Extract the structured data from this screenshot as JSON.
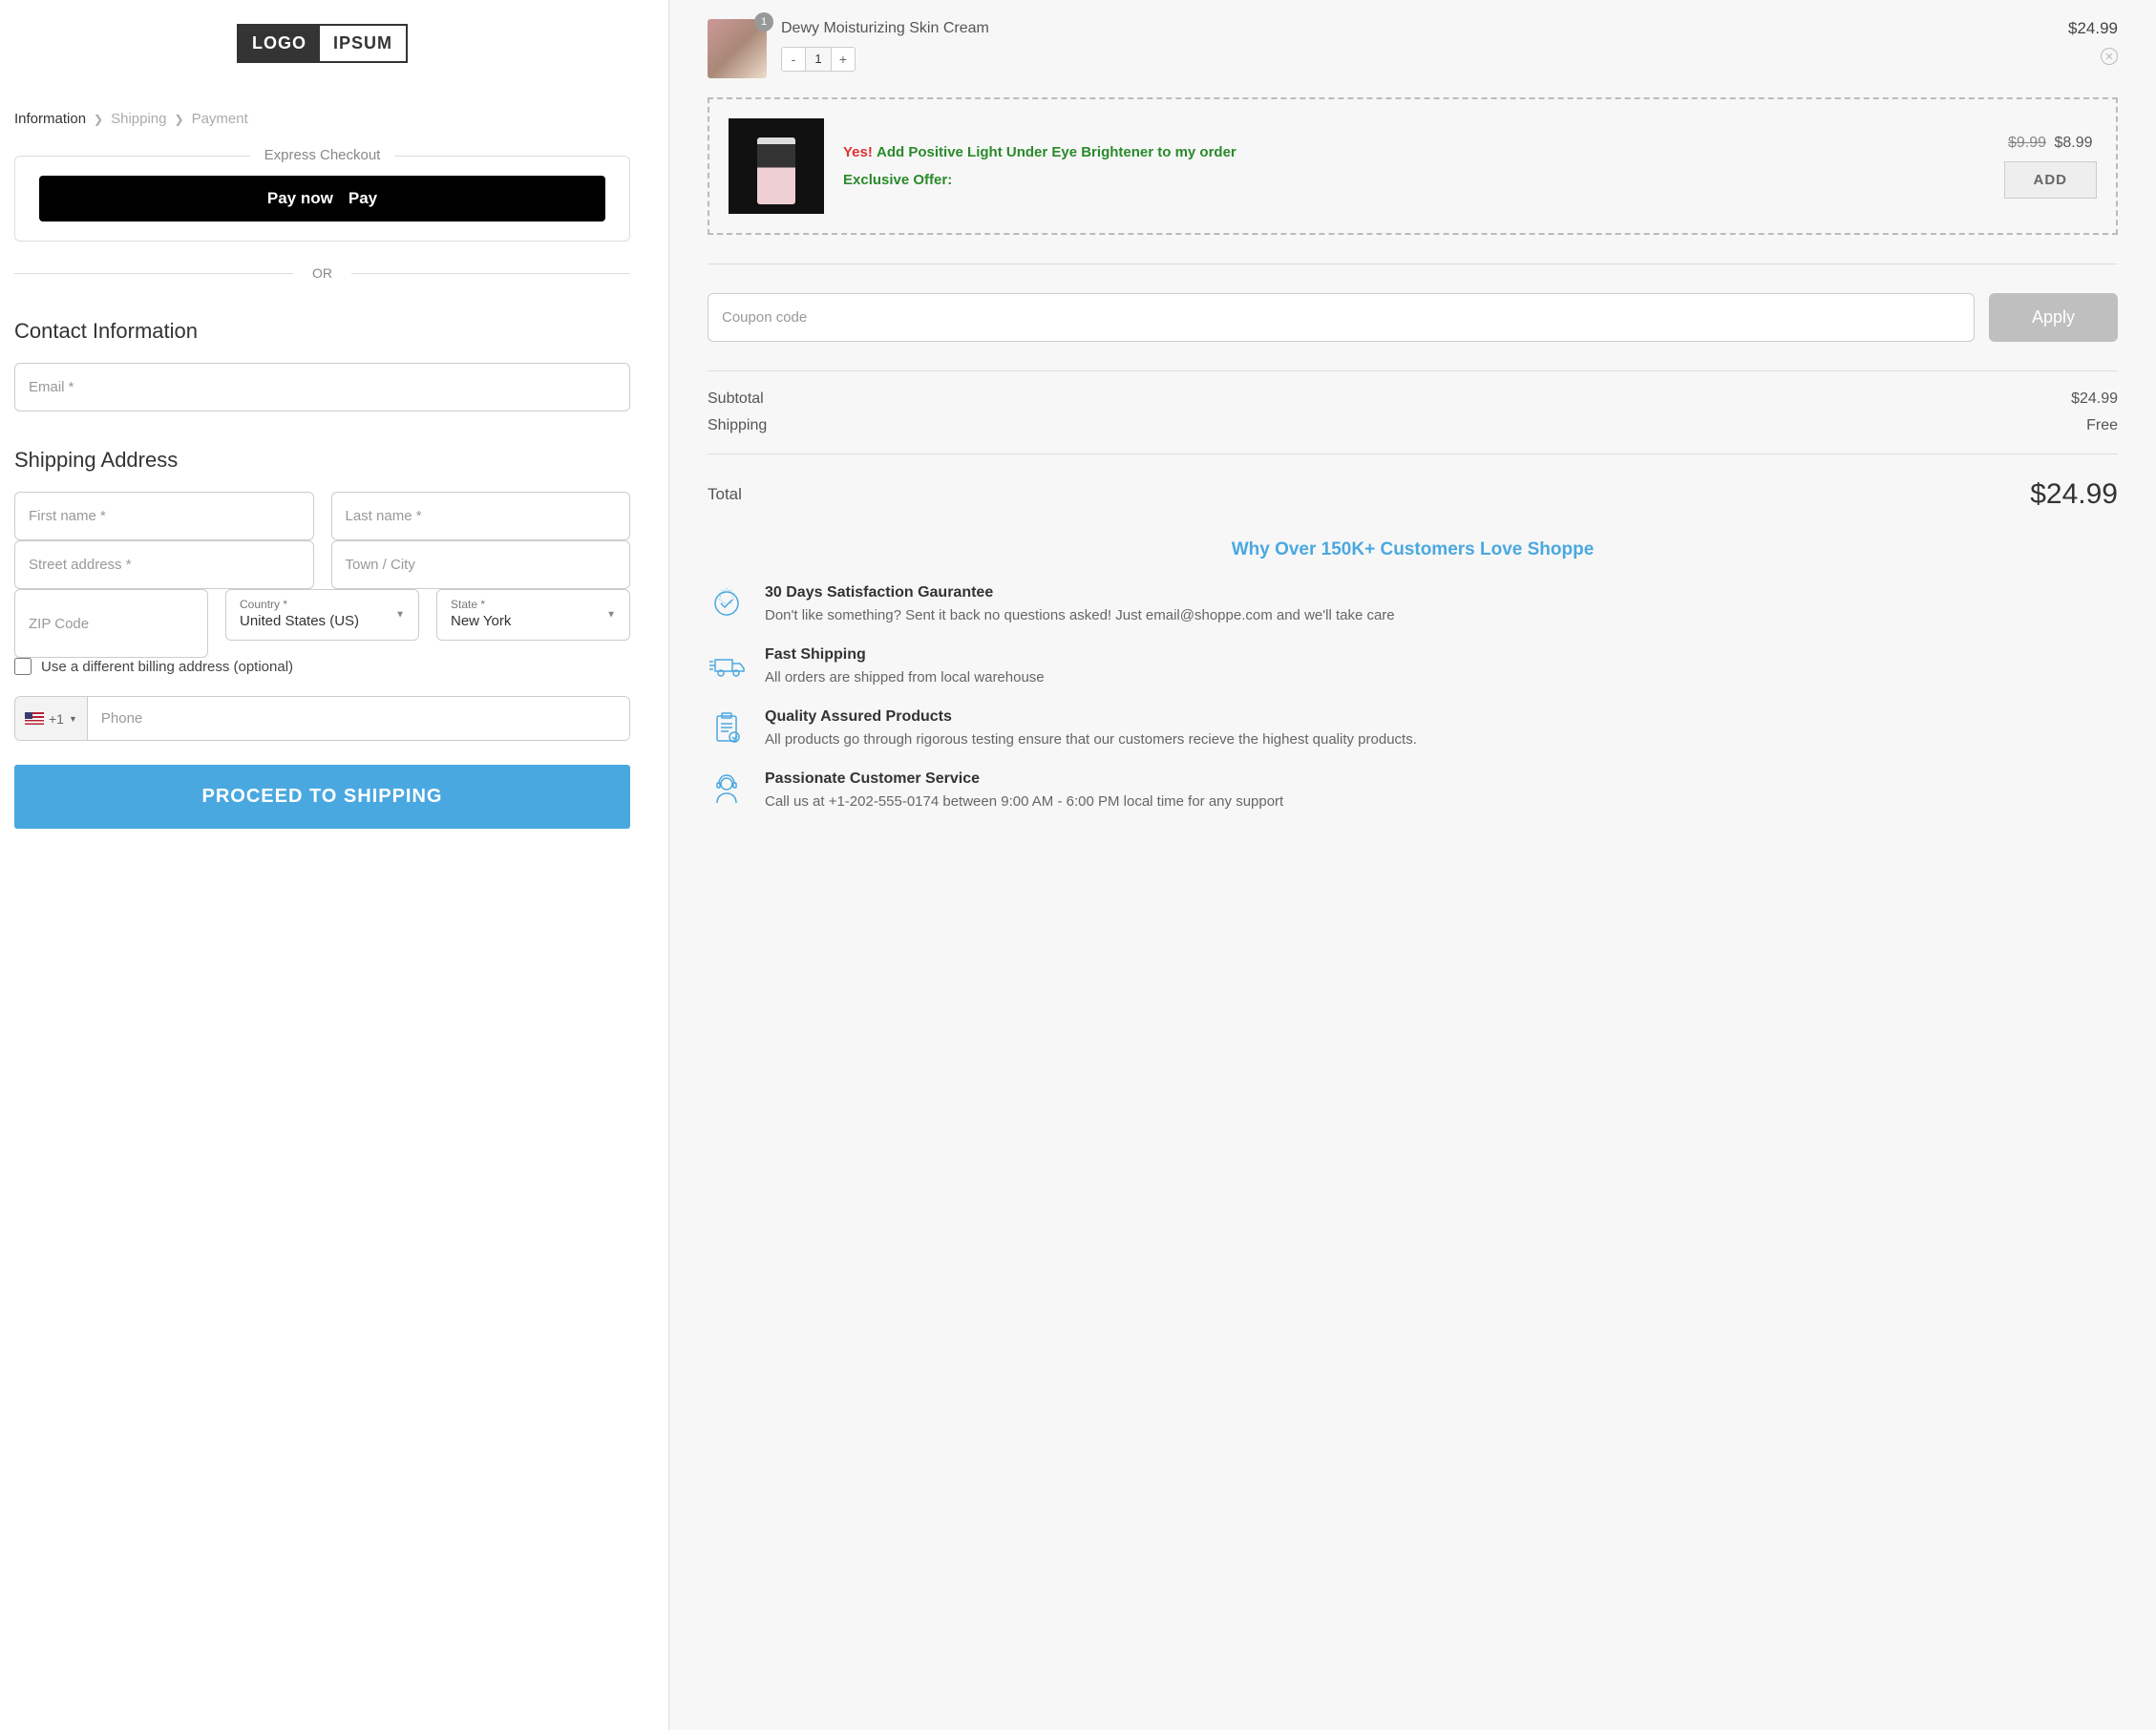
{
  "logo": {
    "left": "LOGO",
    "right": "IPSUM"
  },
  "breadcrumb": {
    "information": "Information",
    "shipping": "Shipping",
    "payment": "Payment"
  },
  "express": {
    "label": "Express Checkout",
    "pay_now": "Pay now",
    "apple_pay": "Pay"
  },
  "or": "OR",
  "contact": {
    "title": "Contact Information",
    "email_ph": "Email *"
  },
  "shipping_addr": {
    "title": "Shipping Address",
    "first_ph": "First name *",
    "last_ph": "Last name *",
    "street_ph": "Street address *",
    "city_ph": "Town / City",
    "zip_ph": "ZIP Code",
    "country_lbl": "Country *",
    "country_val": "United States (US)",
    "state_lbl": "State *",
    "state_val": "New York",
    "diff_billing": "Use a different billing address (optional)",
    "phone_prefix": "+1",
    "phone_ph": "Phone"
  },
  "proceed": "PROCEED TO SHIPPING",
  "cart": {
    "item": {
      "title": "Dewy Moisturizing Skin Cream",
      "qty": "1",
      "price": "$24.99",
      "badge": "1"
    }
  },
  "upsell": {
    "yes": "Yes!",
    "text": "Add Positive Light Under Eye Brightener to my order",
    "exclusive": "Exclusive Offer:",
    "old_price": "$9.99",
    "new_price": "$8.99",
    "add": "ADD"
  },
  "coupon": {
    "ph": "Coupon code",
    "apply": "Apply"
  },
  "summary": {
    "subtotal_lbl": "Subtotal",
    "subtotal_val": "$24.99",
    "shipping_lbl": "Shipping",
    "shipping_val": "Free",
    "total_lbl": "Total",
    "total_val": "$24.99"
  },
  "why": {
    "title": "Why Over 150K+ Customers Love Shoppe",
    "b1_title": "30 Days Satisfaction Gaurantee",
    "b1_text": "Don't like something? Sent it back no questions asked! Just email@shoppe.com and we'll take care",
    "b2_title": "Fast Shipping",
    "b2_text": "All orders are shipped from local warehouse",
    "b3_title": "Quality Assured Products",
    "b3_text": "All products go through rigorous testing ensure that our customers recieve the highest quality products.",
    "b4_title": "Passionate Customer Service",
    "b4_text": "Call us at +1-202-555-0174 between 9:00 AM - 6:00 PM local time for any support"
  }
}
